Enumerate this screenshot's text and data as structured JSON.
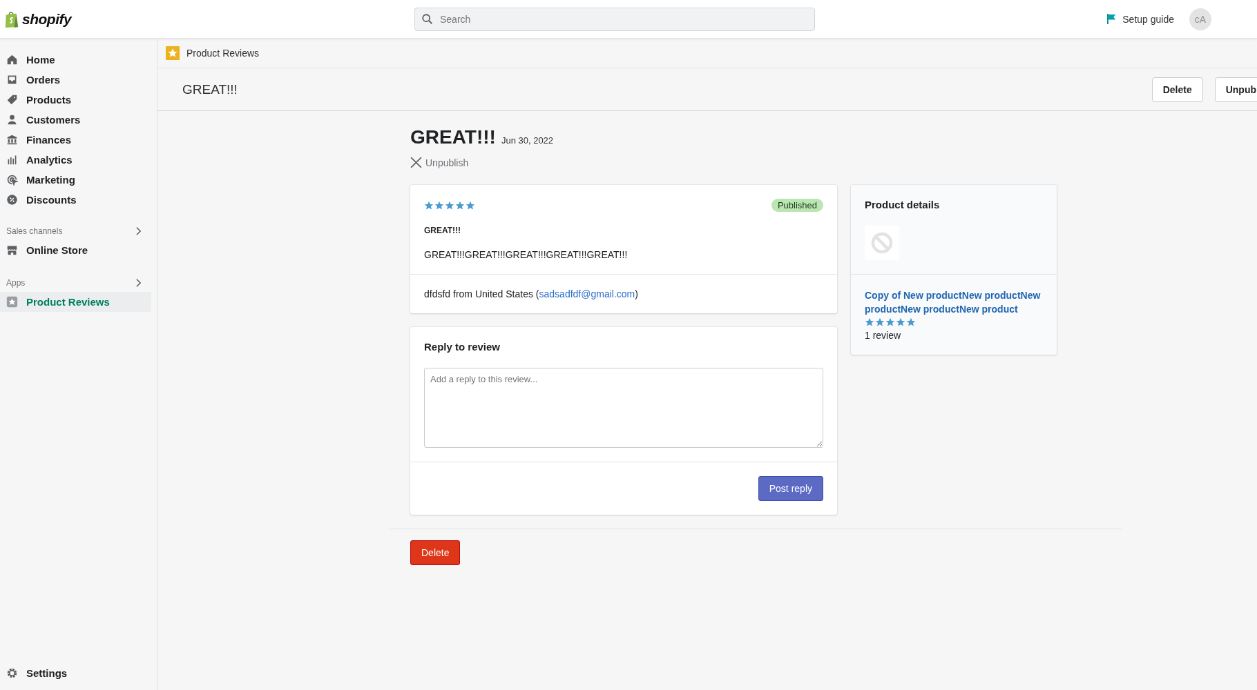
{
  "topbar": {
    "logo": "shopify",
    "search": {
      "placeholder": "Search"
    },
    "setup_guide": "Setup guide",
    "avatar": "cA"
  },
  "sidebar": {
    "items": [
      {
        "label": "Home",
        "kind": "home",
        "selected": false
      },
      {
        "label": "Orders",
        "kind": "orders",
        "selected": false
      },
      {
        "label": "Products",
        "kind": "tag",
        "selected": false
      },
      {
        "label": "Customers",
        "kind": "person",
        "selected": false
      },
      {
        "label": "Finances",
        "kind": "bank",
        "selected": false
      },
      {
        "label": "Analytics",
        "kind": "bars",
        "selected": false
      },
      {
        "label": "Marketing",
        "kind": "target",
        "selected": false
      },
      {
        "label": "Discounts",
        "kind": "discount",
        "selected": false
      }
    ],
    "sections": [
      {
        "title": "Sales channels",
        "items": [
          {
            "label": "Online Store",
            "kind": "store",
            "selected": false
          }
        ]
      },
      {
        "title": "Apps",
        "items": [
          {
            "label": "Product Reviews",
            "kind": "star",
            "selected": true
          }
        ]
      }
    ],
    "settings": "Settings"
  },
  "breadcrumb": "Product Reviews",
  "title_bar": {
    "title": "GREAT!!!",
    "buttons": [
      "Delete",
      "Unpub"
    ]
  },
  "review": {
    "title": "GREAT!!!",
    "date": "Jun 30, 2022",
    "unpublish": "Unpublish",
    "stars": 5,
    "status": "Published",
    "headline": "GREAT!!!",
    "body": "GREAT!!!GREAT!!!GREAT!!!GREAT!!!GREAT!!!",
    "author": "dfdsfd from United States (",
    "email": "sadsadfdf@gmail.com",
    "author_end": ")"
  },
  "reply": {
    "title": "Reply to review",
    "placeholder": "Add a reply to this review...",
    "button": "Post reply"
  },
  "product": {
    "title": "Product details",
    "name": "Copy of New productNew productNew productNew productNew product",
    "stars": 5,
    "count": "1 review"
  },
  "delete_button": "Delete"
}
